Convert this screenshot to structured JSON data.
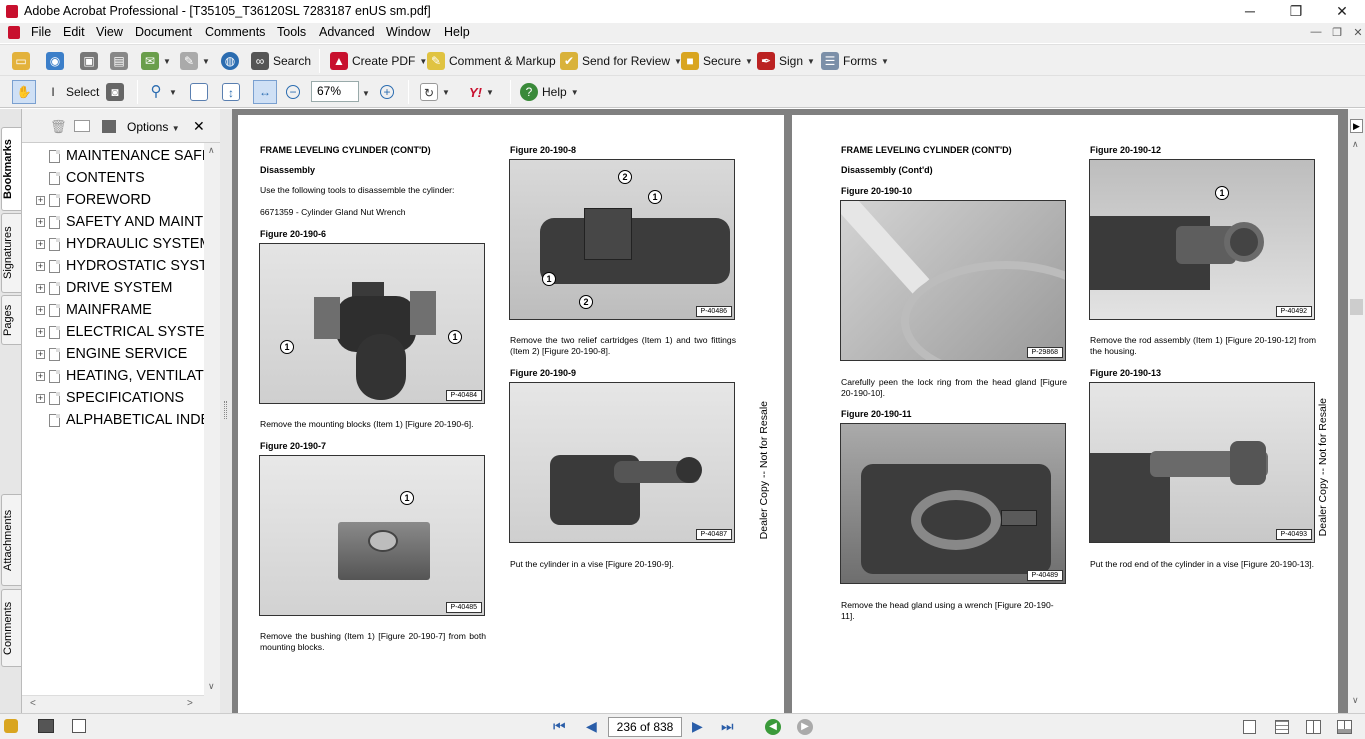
{
  "window": {
    "title": "Adobe Acrobat Professional - [T35105_T36120SL 7283187 enUS sm.pdf]",
    "minimize": "─",
    "restore": "❐",
    "close": "✕"
  },
  "menu": [
    "File",
    "Edit",
    "View",
    "Document",
    "Comments",
    "Tools",
    "Advanced",
    "Window",
    "Help"
  ],
  "toolbar1": {
    "search": "Search",
    "create_pdf": "Create PDF",
    "comment": "Comment & Markup",
    "review": "Send for Review",
    "secure": "Secure",
    "sign": "Sign",
    "forms": "Forms"
  },
  "toolbar2": {
    "select": "Select",
    "zoom": "67%",
    "help": "Help"
  },
  "tabs": {
    "bookmarks": "Bookmarks",
    "signatures": "Signatures",
    "pages": "Pages",
    "attachments": "Attachments",
    "comments": "Comments"
  },
  "bookmarks": {
    "options": "Options",
    "items": [
      {
        "label": "MAINTENANCE SAFETY",
        "expandable": false
      },
      {
        "label": "CONTENTS",
        "expandable": false
      },
      {
        "label": "FOREWORD",
        "expandable": true
      },
      {
        "label": "SAFETY AND MAINTENANCE",
        "expandable": true
      },
      {
        "label": "HYDRAULIC SYSTEM",
        "expandable": true
      },
      {
        "label": "HYDROSTATIC SYSTEM",
        "expandable": true
      },
      {
        "label": "DRIVE SYSTEM",
        "expandable": true
      },
      {
        "label": "MAINFRAME",
        "expandable": true
      },
      {
        "label": "ELECTRICAL SYSTEM",
        "expandable": true
      },
      {
        "label": "ENGINE SERVICE",
        "expandable": true
      },
      {
        "label": "HEATING, VENTILATION",
        "expandable": true
      },
      {
        "label": "SPECIFICATIONS",
        "expandable": true
      },
      {
        "label": "ALPHABETICAL INDEX",
        "expandable": false
      }
    ]
  },
  "status": {
    "page": "236 of 838"
  },
  "left_page": {
    "heading": "FRAME LEVELING CYLINDER (CONT'D)",
    "sub": "Disassembly",
    "p1": "Use the following tools to disassemble the cylinder:",
    "p2": "6671359 - Cylinder Gland Nut Wrench",
    "f6_label": "Figure 20-190-6",
    "f6_tag": "P-40484",
    "f6_text": "Remove the mounting blocks (Item 1) [Figure 20-190-6].",
    "f7_label": "Figure 20-190-7",
    "f7_tag": "P-40485",
    "f7_text": "Remove the bushing (Item 1) [Figure 20-190-7] from both mounting blocks.",
    "f8_label": "Figure 20-190-8",
    "f8_tag": "P-40486",
    "f8_text": "Remove the two relief cartridges (Item 1) and two fittings (Item 2) [Figure 20-190-8].",
    "f9_label": "Figure 20-190-9",
    "f9_tag": "P-40487",
    "f9_text": "Put the cylinder in a vise [Figure 20-190-9].",
    "dealer": "Dealer Copy -- Not for Resale"
  },
  "right_page": {
    "heading": "FRAME LEVELING CYLINDER (CONT'D)",
    "sub": "Disassembly (Cont'd)",
    "f10_label": "Figure 20-190-10",
    "f10_tag": "P-29868",
    "f10_text": "Carefully peen the lock ring from the head gland [Figure 20-190-10].",
    "f11_label": "Figure 20-190-11",
    "f11_tag": "P-40489",
    "f11_text": "Remove the head gland using a wrench [Figure 20-190-11].",
    "f12_label": "Figure 20-190-12",
    "f12_tag": "P-40492",
    "f12_text": "Remove the rod assembly (Item 1) [Figure 20-190-12] from the housing.",
    "f13_label": "Figure 20-190-13",
    "f13_tag": "P-40493",
    "f13_text": "Put the rod end of the cylinder in a vise [Figure 20-190-13].",
    "dealer": "Dealer Copy -- Not for Resale"
  },
  "callouts": {
    "one": "1",
    "two": "2"
  }
}
